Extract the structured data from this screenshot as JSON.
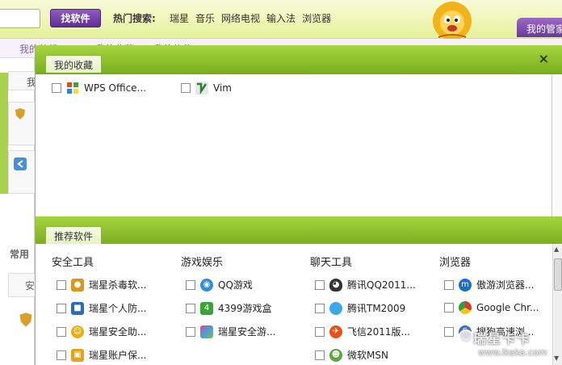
{
  "topbar": {
    "find_button": "找软件",
    "hot_label": "热门搜索:",
    "hot_links": [
      "瑞星",
      "音乐",
      "网络电视",
      "输入法",
      "浏览器"
    ],
    "my_manager": "我的管家"
  },
  "background": {
    "row2_a": "我的装机",
    "row2_b": "我的收藏",
    "row2_c": "我的软件",
    "left_tab": "我",
    "common_label": "常用",
    "left_tab2": "安"
  },
  "dialog": {
    "favorites_tab": "我的收藏",
    "recommended_tab": "推荐软件",
    "close_glyph": "×",
    "favorites": [
      {
        "label": "WPS Office...",
        "icon": "wps-icon"
      },
      {
        "label": "Vim",
        "icon": "vim-icon"
      }
    ],
    "categories": [
      {
        "title": "安全工具",
        "items": [
          {
            "label": "瑞星杀毒软...",
            "icon": "rising-lion-icon",
            "color": "#d89a1e"
          },
          {
            "label": "瑞星个人防...",
            "icon": "shield-icon",
            "color": "#2d6db7"
          },
          {
            "label": "瑞星安全助...",
            "icon": "helper-icon",
            "color": "#e3b01c"
          },
          {
            "label": "瑞星账户保...",
            "icon": "lock-icon",
            "color": "#e0a21a"
          }
        ]
      },
      {
        "title": "游戏娱乐",
        "items": [
          {
            "label": "QQ游戏",
            "icon": "qq-game-icon",
            "color": "#2f8fd8"
          },
          {
            "label": "4399游戏盒",
            "icon": "game-box-icon",
            "color": "#3aa43a"
          },
          {
            "label": "瑞星安全游...",
            "icon": "colorful-icon",
            "color": "#d84a8c"
          }
        ]
      },
      {
        "title": "聊天工具",
        "items": [
          {
            "label": "腾讯QQ2011...",
            "icon": "qq-penguin-icon",
            "color": "#333333"
          },
          {
            "label": "腾讯TM2009",
            "icon": "tm-icon",
            "color": "#3aa7e8"
          },
          {
            "label": "飞信2011版...",
            "icon": "fetion-icon",
            "color": "#e8501c"
          },
          {
            "label": "微软MSN",
            "icon": "msn-icon",
            "color": "#5fa542"
          }
        ]
      },
      {
        "title": "浏览器",
        "items": [
          {
            "label": "傲游浏览器...",
            "icon": "maxthon-icon",
            "color": "#1b6fc9"
          },
          {
            "label": "Google Chr...",
            "icon": "chrome-icon",
            "color": "#d23b2d"
          },
          {
            "label": "搜狗高速浏...",
            "icon": "sogou-icon",
            "color": "#3d6fc6"
          }
        ]
      }
    ]
  },
  "watermark": {
    "top": "瑞星卡卡",
    "bottom": "www.ikaka.com"
  }
}
